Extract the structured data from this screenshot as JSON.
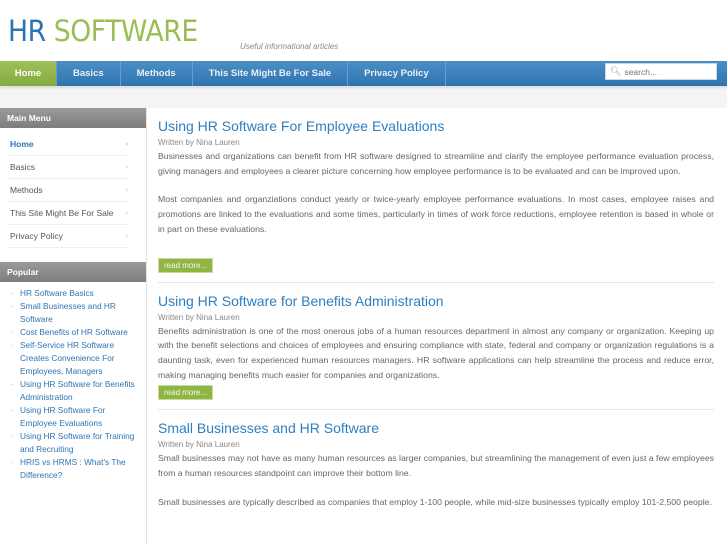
{
  "site": {
    "title_part1": "HR",
    "title_part2": "SOFTWARE",
    "tagline": "Useful informational articles"
  },
  "nav": {
    "items": [
      "Home",
      "Basics",
      "Methods",
      "This Site Might Be For Sale",
      "Privacy Policy"
    ],
    "search_placeholder": "search..."
  },
  "sidebar": {
    "main_menu_title": "Main Menu",
    "menu": [
      "Home",
      "Basics",
      "Methods",
      "This Site Might Be For Sale",
      "Privacy Policy"
    ],
    "popular_title": "Popular",
    "popular": [
      "HR Software Basics",
      "Small Businesses and HR Software",
      "Cost Benefits of HR Software",
      "Self-Service HR Software Creates Convenience For Employees, Managers",
      "Using HR Software for Benefits Administration",
      "Using HR Software For Employee Evaluations",
      "Using HR Software for Training and Recruiting",
      "HRIS vs HRMS : What's The Difference?"
    ]
  },
  "posts": [
    {
      "title": "Using HR Software For Employee Evaluations",
      "author": "Written by Nina Lauren",
      "p1": "Businesses and organizations can benefit from HR software designed to streamline and clarify the employee performance evaluation process, giving managers and employees a clearer picture concerning how employee performance is to be evaluated and can be improved upon.",
      "p2": "Most companies and organziations conduct yearly or twice-yearly employee performance evaluations. In most cases, employee raises and promotions are linked to the evaluations and some times, particularly in times of work force reductions, employee retention is based in whole or in part on these evaluations.",
      "read_more": "read more..."
    },
    {
      "title": "Using HR Software for Benefits Administration",
      "author": "Written by Nina Lauren",
      "p1": "Benefits administration is one of the most onerous jobs of a human resources department in almost any company or organization. Keeping up with the benefit selections and choices of employees and ensuring compliance with state, federal and company or organization regulations is a daunting task, even for experienced human resources managers. HR software applications can help streamline the process and reduce error, making managing benefits much easier for companies and organizations.",
      "read_more": "read more..."
    },
    {
      "title": "Small Businesses and HR Software",
      "author": "Written by Nina Lauren",
      "p1": "Small businesses may not have as many human resources as larger companies, but streamlining the management of even just a few employees from a human resources standpoint can improve their bottom line.",
      "p2": "Small businesses are typically described as companies that employ 1-100 people, while mid-size businesses typically employ 101-2,500 people."
    }
  ]
}
